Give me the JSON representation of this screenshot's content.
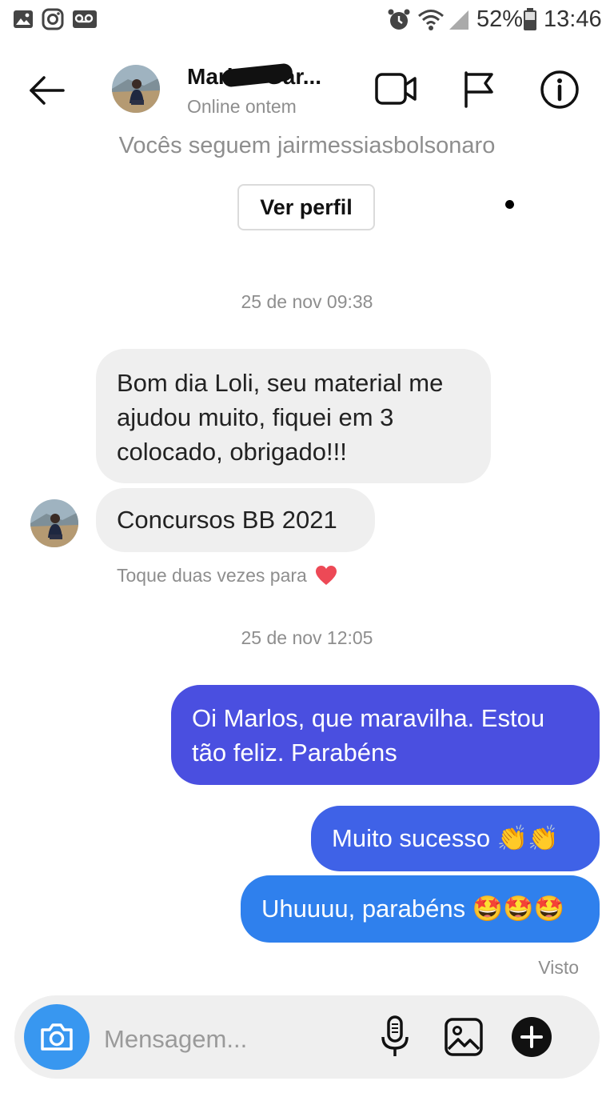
{
  "status_bar": {
    "battery": "52%",
    "time": "13:46"
  },
  "header": {
    "name": "Marlos Gar...",
    "presence": "Online ontem"
  },
  "thread_info": {
    "mutual_follow": "Vocês seguem jairmessiasbolsonaro",
    "view_profile_label": "Ver perfil"
  },
  "messages": {
    "timestamp_1": "25 de nov 09:38",
    "in_1": "Bom dia Loli, seu material me ajudou muito, fiquei em 3 colocado, obrigado!!!",
    "in_2": "Concursos BB 2021",
    "like_hint": "Toque duas vezes para",
    "timestamp_2": "25 de nov 12:05",
    "out_1": "Oi Marlos, que maravilha. Estou tão feliz. Parabéns",
    "out_2": "Muito sucesso 👏👏",
    "out_3": "Uhuuuu, parabéns 🤩🤩🤩",
    "seen": "Visto"
  },
  "composer": {
    "placeholder": "Mensagem..."
  },
  "colors": {
    "accent_blue": "#3897f0",
    "bubble_out_top": "#4a4fe0",
    "bubble_out_bottom": "#2f80ed",
    "bubble_in": "#efefef",
    "heart": "#ed4956"
  },
  "icons": [
    "gallery-icon",
    "instagram-icon",
    "voicemail-icon",
    "alarm-icon",
    "wifi-icon",
    "signal-icon",
    "battery-icon",
    "back-arrow-icon",
    "video-call-icon",
    "flag-icon",
    "info-icon",
    "camera-icon",
    "microphone-icon",
    "image-icon",
    "plus-icon",
    "heart-icon"
  ]
}
